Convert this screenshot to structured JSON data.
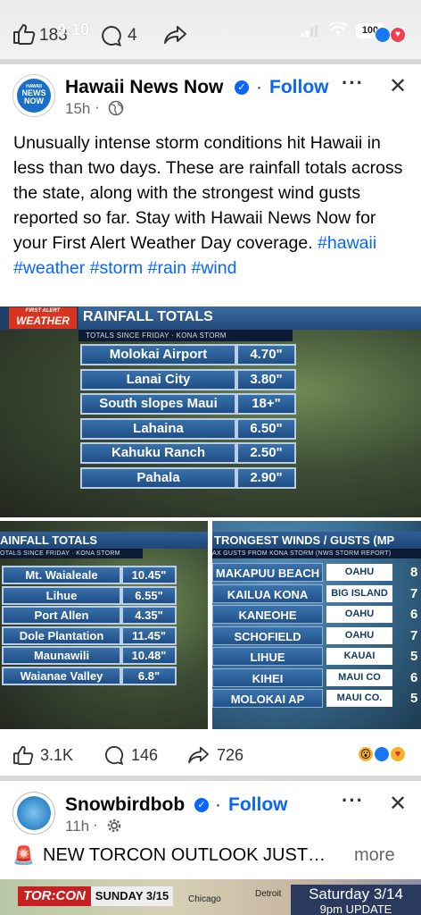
{
  "status_bar": {
    "time": "9:10",
    "battery": "100"
  },
  "top_reactions": {
    "likes": "183",
    "comments": "4"
  },
  "post1": {
    "author": "Hawaii News Now",
    "follow": "Follow",
    "time": "15h",
    "body": "Unusually intense storm conditions hit Hawaii in less than two days. These are rainfall totals across the state, along with the strongest wind gusts reported so far. Stay with Hawaii News Now for your First Alert Weather Day coverage.",
    "hashtags": [
      "#hawaii",
      "#weather",
      "#storm",
      "#rain",
      "#wind"
    ],
    "logo_text": [
      "HAWAII",
      "NEWS",
      "NOW"
    ],
    "graphic1": {
      "badge_top": "FIRST ALERT",
      "badge_main": "WEATHER",
      "title": "RAINFALL TOTALS",
      "subtitle": "TOTALS SINCE FRIDAY · KONA STORM",
      "rows": [
        {
          "name": "Molokai Airport",
          "value": "4.70\""
        },
        {
          "name": "Lanai City",
          "value": "3.80\""
        },
        {
          "name": "South slopes Maui",
          "value": "18+\""
        },
        {
          "name": "Lahaina",
          "value": "6.50\""
        },
        {
          "name": "Kahuku Ranch",
          "value": "2.50\""
        },
        {
          "name": "Pahala",
          "value": "2.90\""
        }
      ]
    },
    "graphic2": {
      "title": "AINFALL TOTALS",
      "subtitle": "OTALS SINCE FRIDAY · KONA STORM",
      "rows": [
        {
          "name": "Mt. Waialeale",
          "value": "10.45\""
        },
        {
          "name": "Lihue",
          "value": "6.55\""
        },
        {
          "name": "Port Allen",
          "value": "4.35\""
        },
        {
          "name": "Dole Plantation",
          "value": "11.45\""
        },
        {
          "name": "Maunawili",
          "value": "10.48\""
        },
        {
          "name": "Waianae Valley",
          "value": "6.8\""
        }
      ]
    },
    "graphic3": {
      "title": "TRONGEST WINDS / GUSTS (MP",
      "subtitle": "AX GUSTS FROM KONA STORM (NWS STORM REPORT)",
      "rows": [
        {
          "name": "MAKAPUU BEACH",
          "region": "OAHU",
          "value": "8"
        },
        {
          "name": "KAILUA KONA",
          "region": "BIG ISLAND",
          "value": "7"
        },
        {
          "name": "KANEOHE",
          "region": "OAHU",
          "value": "6"
        },
        {
          "name": "SCHOFIELD",
          "region": "OAHU",
          "value": "7"
        },
        {
          "name": "LIHUE",
          "region": "KAUAI",
          "value": "5"
        },
        {
          "name": "KIHEI",
          "region": "MAUI CO",
          "value": "6"
        },
        {
          "name": "MOLOKAI AP",
          "region": "MAUI CO.",
          "value": "5"
        }
      ]
    },
    "stats": {
      "likes": "3.1K",
      "comments": "146",
      "shares": "726"
    }
  },
  "post2": {
    "author": "Snowbirdbob",
    "follow": "Follow",
    "time": "11h",
    "text": "NEW TORCON OUTLOOK JUST…",
    "more": "more",
    "preview": {
      "brand": "TOR:CON",
      "date": "SUNDAY 3/15",
      "city1": "Chicago",
      "city2": "Detroit",
      "right_title": "Saturday 3/14",
      "right_sub": "9pm UPDATE"
    }
  },
  "colors": {
    "accent": "#0866ff",
    "graphic_blue": "#2a5d95"
  }
}
